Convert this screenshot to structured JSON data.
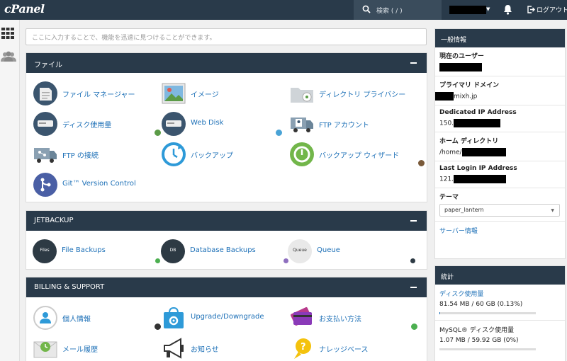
{
  "topbar": {
    "logo": "cPanel",
    "search_placeholder": "検索 ( / )",
    "logout_label": "ログアウト"
  },
  "search": {
    "placeholder": "ここに入力することで、機能を迅速に見つけることができます。"
  },
  "files": {
    "title": "ファイル",
    "items": [
      {
        "label": "ファイル マネージャー"
      },
      {
        "label": "イメージ"
      },
      {
        "label": "ディレクトリ プライバシー"
      },
      {
        "label": "ディスク使用量"
      },
      {
        "label": "Web Disk"
      },
      {
        "label": "FTP アカウント"
      },
      {
        "label": "FTP の接続"
      },
      {
        "label": "バックアップ"
      },
      {
        "label": "バックアップ ウィザード"
      },
      {
        "label": "Git™ Version Control"
      }
    ]
  },
  "jetbackup": {
    "title": "JETBACKUP",
    "items": [
      {
        "label": "File Backups",
        "icon_text": "Files"
      },
      {
        "label": "Database Backups",
        "icon_text": "DB"
      },
      {
        "label": "Queue",
        "icon_text": "Queue"
      }
    ]
  },
  "billing": {
    "title": "BILLING & SUPPORT",
    "items": [
      {
        "label": "個人情報"
      },
      {
        "label": "Upgrade/Downgrade"
      },
      {
        "label": "お支払い方法"
      },
      {
        "label": "メール履歴"
      },
      {
        "label": "お知らせ"
      },
      {
        "label": "ナレッジベース"
      }
    ]
  },
  "general": {
    "title": "一般情報",
    "current_user_label": "現在のユーザー",
    "primary_domain_label": "プライマリ ドメイン",
    "primary_domain_suffix": "mixh.jp",
    "dedicated_ip_label": "Dedicated IP Address",
    "dedicated_ip_prefix": "150.",
    "home_dir_label": "ホーム ディレクトリ",
    "home_dir_prefix": "/home/",
    "last_login_label": "Last Login IP Address",
    "last_login_prefix": "121.",
    "theme_label": "テーマ",
    "theme_value": "paper_lantern",
    "server_info": "サーバー情報"
  },
  "stats": {
    "title": "統計",
    "disk_label": "ディスク使用量",
    "disk_value": "81.54 MB / 60 GB   (0.13%)",
    "disk_fraction": 0.0013,
    "mysql_label": "MySQL® ディスク使用量",
    "mysql_value": "1.07 MB / 59.92 GB   (0%)",
    "mysql_fraction": 0.0
  },
  "colors": {
    "header": "#293a4a",
    "link": "#1d70b7"
  }
}
